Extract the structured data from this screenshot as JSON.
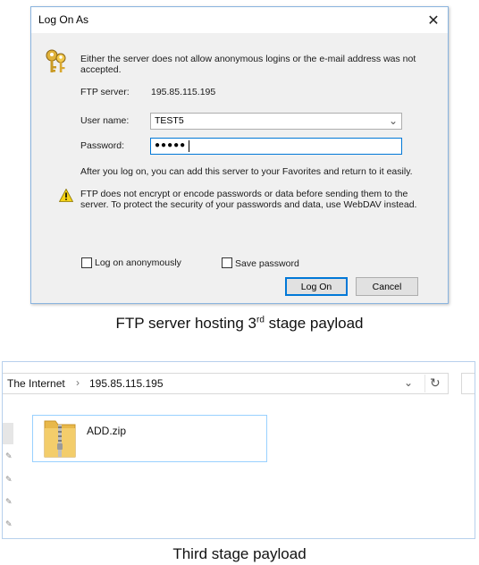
{
  "dialog": {
    "title": "Log On As",
    "intro": "Either the server does not allow anonymous logins or the e-mail address was not accepted.",
    "ftp_server_label": "FTP server:",
    "ftp_server_value": "195.85.115.195",
    "username_label": "User name:",
    "username_value": "TEST5",
    "password_label": "Password:",
    "password_mask": "●●●●●",
    "after_logon": "After you log on, you can add this server to your Favorites and return to it easily.",
    "warning": "FTP does not encrypt or encode passwords or data before sending them to the server.  To protect the security of your passwords and data, use WebDAV instead.",
    "anon_label": "Log on anonymously",
    "save_label": "Save password",
    "logon_button": "Log On",
    "cancel_button": "Cancel",
    "close_glyph": "✕"
  },
  "caption_top": {
    "prefix": "FTP server hosting 3",
    "sup": "rd",
    "suffix": " stage payload"
  },
  "explorer": {
    "crumb_root": "The Internet",
    "crumb_sep": "›",
    "crumb_ip": "195.85.115.195",
    "dropdown_glyph": "⌄",
    "refresh_glyph": "↻",
    "file_name": "ADD.zip"
  },
  "caption_bottom": "Third stage payload",
  "colors": {
    "accent": "#0078d7",
    "tile_border": "#99d1ff",
    "folder": "#e8b84a"
  },
  "icons": [
    "keys-icon",
    "warning-icon",
    "zip-folder-icon",
    "refresh-icon",
    "chevron-down-icon",
    "close-icon",
    "pin-icon"
  ]
}
